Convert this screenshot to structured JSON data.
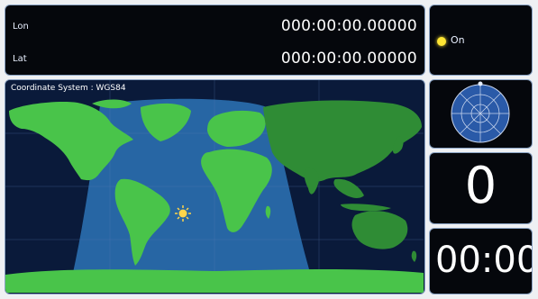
{
  "coordinates": {
    "lon_label": "Lon",
    "lon_value": "000:00:00.00000",
    "lat_label": "Lat",
    "lat_value": "000:00:00.00000"
  },
  "status": {
    "indicator_color": "#ffe533",
    "label": "On"
  },
  "map": {
    "coordinate_system_label": "Coordinate System : WGS84",
    "colors": {
      "ocean": "#0a1a3a",
      "day_region": "#2a6fb0",
      "land": "#49c44a",
      "land_night": "#2f8c35",
      "sun": "#ffd54a"
    }
  },
  "compass": {
    "icon": "sky-compass-icon"
  },
  "counter": {
    "value": "0"
  },
  "clock": {
    "value": "00:00"
  }
}
